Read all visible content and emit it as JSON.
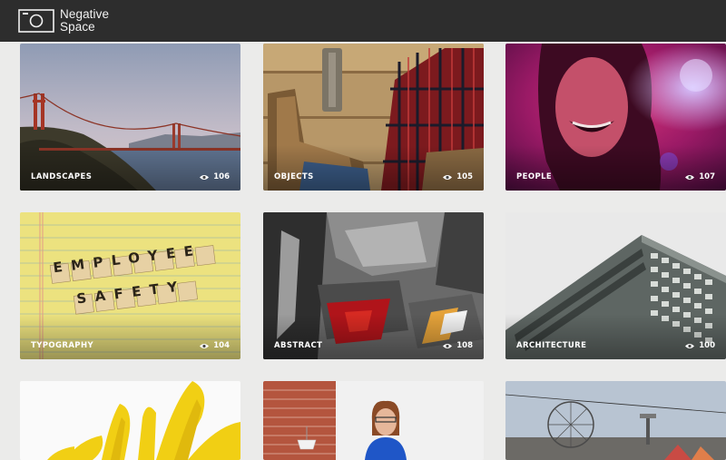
{
  "brand": {
    "name_line1": "Negative",
    "name_line2": "Space",
    "icon": "camera-frame-icon"
  },
  "gallery": {
    "tiles": [
      {
        "category": "LANDSCAPES",
        "views": "106"
      },
      {
        "category": "OBJECTS",
        "views": "105"
      },
      {
        "category": "PEOPLE",
        "views": "107"
      },
      {
        "category": "TYPOGRAPHY",
        "views": "104"
      },
      {
        "category": "ABSTRACT",
        "views": "108"
      },
      {
        "category": "ARCHITECTURE",
        "views": "100"
      }
    ],
    "view_icon": "eye-icon",
    "typography_tiles": [
      "EMPLOYEE",
      "SAFETY"
    ]
  },
  "colors": {
    "topbar": "#2d2d2d",
    "background": "#ebebea"
  }
}
